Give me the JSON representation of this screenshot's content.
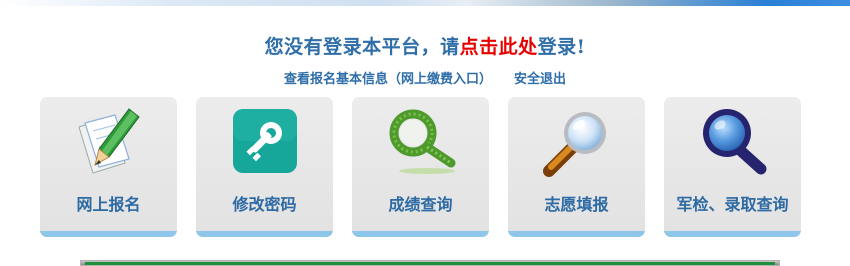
{
  "header": {
    "prompt_before": "您没有登录本平台，请",
    "prompt_link": "点击此处",
    "prompt_after": "登录!"
  },
  "links": {
    "view_info": "查看报名基本信息（网上缴费入口）",
    "logout": "安全退出"
  },
  "cards": [
    {
      "label": "网上报名",
      "icon": "pencil-paper-icon"
    },
    {
      "label": "修改密码",
      "icon": "key-icon"
    },
    {
      "label": "成绩查询",
      "icon": "grass-magnifier-icon"
    },
    {
      "label": "志愿填报",
      "icon": "magnifying-glass-icon"
    },
    {
      "label": "军检、录取查询",
      "icon": "blue-magnifier-icon"
    }
  ],
  "colors": {
    "accent": "#2f6ea8",
    "link_red": "#e60000",
    "card_bar": "#8ec6ea"
  }
}
